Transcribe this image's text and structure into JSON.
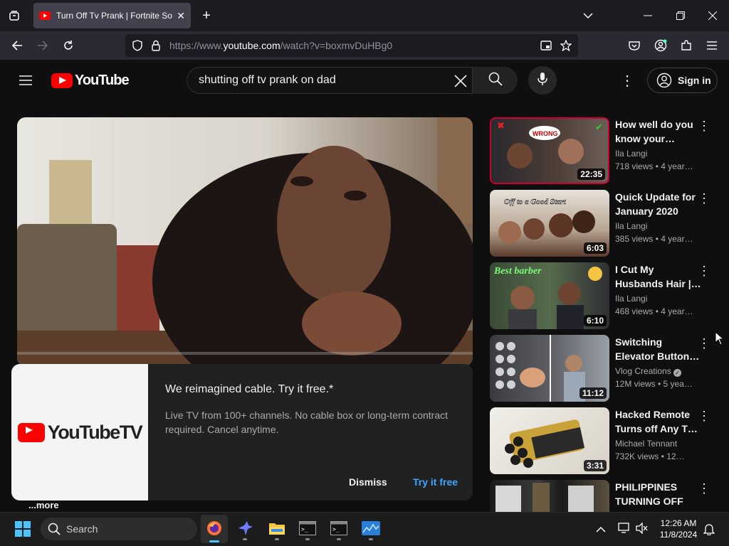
{
  "browser": {
    "tab_title": "Turn Off Tv Prank | Fortnite So",
    "url_prefix": "https://www.",
    "url_domain": "youtube.com",
    "url_path": "/watch?v=boxmvDuHBg0"
  },
  "youtube": {
    "logo_text": "YouTube",
    "search_value": "shutting off tv prank on dad",
    "sign_in": "Sign in"
  },
  "promo": {
    "logo_text": "YouTubeTV",
    "title": "We reimagined cable. Try it free.*",
    "description": "Live TV from 100+ channels. No cable box or long-term contract required. Cancel anytime.",
    "dismiss": "Dismiss",
    "try_free": "Try it free"
  },
  "description_more": "...more",
  "recommendations": [
    {
      "title": "How well do you know your…",
      "channel": "Ila Langi",
      "meta": "718 views • 4 year…",
      "duration": "22:35"
    },
    {
      "title": "Quick Update for January 2020",
      "channel": "Ila Langi",
      "meta": "385 views • 4 year…",
      "duration": "6:03"
    },
    {
      "title": "I Cut My Husbands Hair |…",
      "channel": "Ila Langi",
      "meta": "468 views • 4 year…",
      "duration": "6:10"
    },
    {
      "title": "Switching Elevator Button…",
      "channel": "Vlog Creations",
      "meta": "12M views • 5 yea…",
      "duration": "11:12"
    },
    {
      "title": "Hacked Remote Turns off Any T…",
      "channel": "Michael Tennant",
      "meta": "732K views • 12…",
      "duration": "3:31"
    },
    {
      "title": "PHILIPPINES TURNING OFF T…",
      "channel": "",
      "meta": "",
      "duration": ""
    }
  ],
  "thumb_text": {
    "wrong": "WRONG",
    "good_start": "Off to a Good Start",
    "best_barber": "Best barber"
  },
  "taskbar": {
    "search": "Search",
    "time": "12:26 AM",
    "date": "11/8/2024"
  }
}
